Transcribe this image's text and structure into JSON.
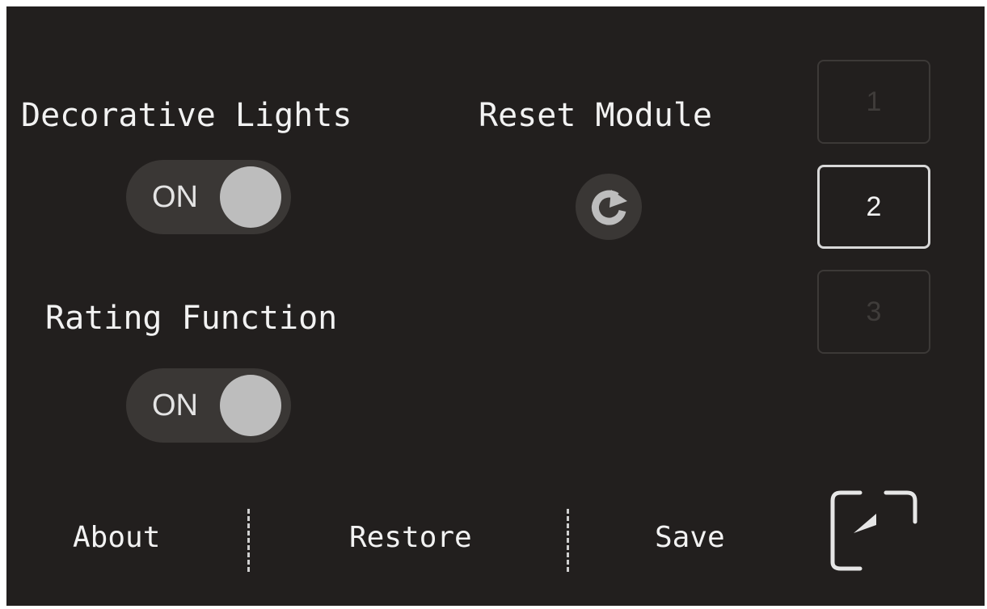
{
  "settings": {
    "decorative_lights": {
      "label": "Decorative Lights",
      "toggle_text": "ON",
      "state": "on"
    },
    "reset_module": {
      "label": "Reset Module"
    },
    "rating_function": {
      "label": "Rating Function",
      "toggle_text": "ON",
      "state": "on"
    }
  },
  "modules": [
    {
      "label": "1",
      "selected": false
    },
    {
      "label": "2",
      "selected": true
    },
    {
      "label": "3",
      "selected": false
    }
  ],
  "bottom_bar": {
    "about": "About",
    "restore": "Restore",
    "save": "Save"
  },
  "icons": {
    "reset": "refresh-icon",
    "back": "back-arrow-icon"
  },
  "colors": {
    "background": "#221f1e",
    "toggle_track": "#3a3735",
    "toggle_knob": "#bdbdbd",
    "text": "#f2f2f2",
    "selected_border": "#d8d8d8",
    "disabled_text": "#3f3c3a"
  }
}
